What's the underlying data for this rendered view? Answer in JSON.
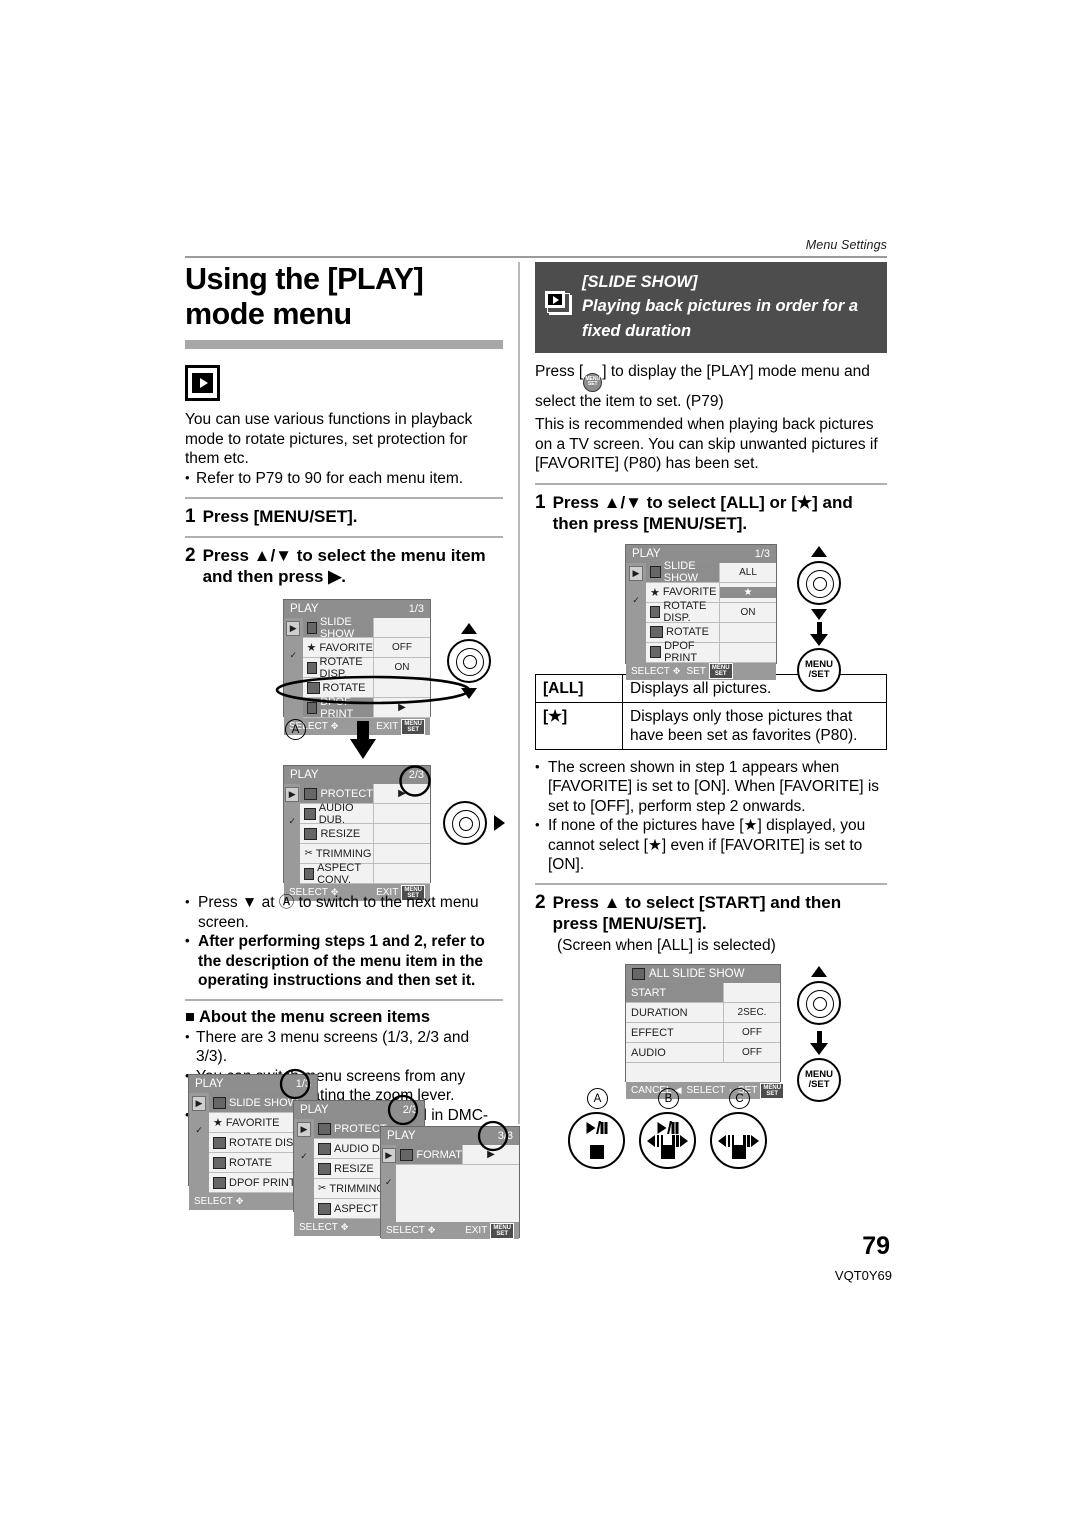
{
  "running_head": "Menu Settings",
  "page_number": "79",
  "doc_code": "VQT0Y69",
  "left": {
    "title": "Using the [PLAY] mode menu",
    "mode_icon": "play-mode-icon",
    "intro": "You can use various functions in playback mode to rotate pictures, set protection for them etc.",
    "intro_bullet": "Refer to P79 to 90 for each menu item.",
    "step1_num": "1",
    "step1_text": "Press [MENU/SET].",
    "step2_num": "2",
    "step2_text": "Press ▲/▼ to select the menu item and then press ▶.",
    "callout_a": "A",
    "note_bullet_1": "Press ▼ at Ⓐ to switch to the next menu screen.",
    "note_bullet_2": "After performing steps 1 and 2, refer to the description of the menu item in the operating instructions and then set it.",
    "section_heading": "About the menu screen items",
    "section_bullets": [
      "There are 3 menu screens (1/3, 2/3 and 3/3).",
      "You can switch menu screens from any menu item by rotating the zoom lever.",
      "The [COPY] function can be used in DMC-FX3."
    ],
    "lcd1": {
      "title": "PLAY",
      "page": "1/3",
      "rows": [
        {
          "icon": "slideshow-icon",
          "label": "SLIDE SHOW",
          "value": ""
        },
        {
          "icon": "star-icon",
          "label": "FAVORITE",
          "value": "OFF"
        },
        {
          "icon": "rotate-disp-icon",
          "label": "ROTATE DISP.",
          "value": "ON"
        },
        {
          "icon": "rotate-icon",
          "label": "ROTATE",
          "value": ""
        },
        {
          "icon": "dpof-icon",
          "label": "DPOF PRINT",
          "value": ""
        }
      ],
      "selected_row": 4,
      "footer_left": "SELECT",
      "footer_right": "EXIT",
      "footer_badge": "MENU/SET"
    },
    "lcd2": {
      "title": "PLAY",
      "page": "2/3",
      "rows": [
        {
          "icon": "protect-icon",
          "label": "PROTECT",
          "value": ""
        },
        {
          "icon": "audio-dub-icon",
          "label": "AUDIO DUB.",
          "value": ""
        },
        {
          "icon": "resize-icon",
          "label": "RESIZE",
          "value": ""
        },
        {
          "icon": "trimming-icon",
          "label": "TRIMMING",
          "value": ""
        },
        {
          "icon": "aspect-conv-icon",
          "label": "ASPECT CONV.",
          "value": ""
        }
      ],
      "selected_row": 0,
      "footer_left": "SELECT",
      "footer_right": "EXIT",
      "footer_badge": "MENU/SET"
    },
    "stack": {
      "s1": {
        "title": "PLAY",
        "page": "1/3",
        "rows": [
          "SLIDE SHOW",
          "FAVORITE",
          "ROTATE DISP.",
          "ROTATE",
          "DPOF PRINT"
        ],
        "selected_row": 0,
        "footer_left": "SELECT"
      },
      "s2": {
        "title": "PLAY",
        "page": "2/3",
        "rows": [
          "PROTECT",
          "AUDIO DUB.",
          "RESIZE",
          "TRIMMING",
          "ASPECT CONV."
        ],
        "selected_row": 0,
        "footer_left": "SELECT"
      },
      "s3": {
        "title": "PLAY",
        "page": "3/3",
        "rows": [
          "FORMAT"
        ],
        "selected_row": 0,
        "footer_left": "SELECT",
        "footer_right": "EXIT",
        "footer_badge": "MENU/SET"
      }
    }
  },
  "right": {
    "banner_title": "[SLIDE SHOW]",
    "banner_sub_line1": "Playing back pictures in order for a",
    "banner_sub_line2": "fixed duration",
    "banner_icon": "slideshow-stack-icon",
    "para1_a": "Press [",
    "para1_b": "] to display the [PLAY] mode menu and select the item to set. (P79)",
    "para2": "This is recommended when playing back pictures on a TV screen. You can skip unwanted pictures if [FAVORITE] (P80) has been set.",
    "step1_num": "1",
    "step1_text": "Press ▲/▼ to select [ALL] or [★] and then press [MENU/SET].",
    "lcd3": {
      "title": "PLAY",
      "page": "1/3",
      "rows": [
        {
          "icon": "slideshow-icon",
          "label": "SLIDE SHOW",
          "value": "ALL"
        },
        {
          "icon": "star-icon",
          "label": "FAVORITE",
          "value": "★"
        },
        {
          "icon": "rotate-disp-icon",
          "label": "ROTATE DISP.",
          "value": "ON"
        },
        {
          "icon": "rotate-icon",
          "label": "ROTATE",
          "value": ""
        },
        {
          "icon": "dpof-icon",
          "label": "DPOF PRINT",
          "value": ""
        }
      ],
      "selected_label_row": 0,
      "selected_value_row": 1,
      "footer_left": "SELECT",
      "footer_mid": "SET",
      "footer_badge": "MENU/SET"
    },
    "table": {
      "rows": [
        {
          "key": "[ALL]",
          "desc": "Displays all pictures."
        },
        {
          "key": "[★]",
          "desc": "Displays only those pictures that have been set as favorites (P80)."
        }
      ]
    },
    "note_bullet_1": "The screen shown in step 1 appears when [FAVORITE] is set to [ON]. When [FAVORITE] is set to [OFF], perform step 2 onwards.",
    "note_bullet_2": "If none of the pictures have [★] displayed, you cannot select [★] even if [FAVORITE] is set to [ON].",
    "step2_num": "2",
    "step2_text": "Press ▲ to select [START] and then press [MENU/SET].",
    "step2_caption": "(Screen when [ALL] is selected)",
    "lcd4": {
      "title": "ALL SLIDE SHOW",
      "rows": [
        {
          "label": "START",
          "value": ""
        },
        {
          "label": "DURATION",
          "value": "2SEC."
        },
        {
          "label": "EFFECT",
          "value": "OFF"
        },
        {
          "label": "AUDIO",
          "value": "OFF"
        }
      ],
      "selected_row": 0,
      "footer_cancel": "CANCEL",
      "footer_select": "SELECT",
      "footer_set": "SET",
      "footer_badge": "MENU/SET"
    },
    "pb_labels": [
      "A",
      "B",
      "C"
    ],
    "menuset_label_top": "MENU",
    "menuset_label_bot": "/SET"
  }
}
